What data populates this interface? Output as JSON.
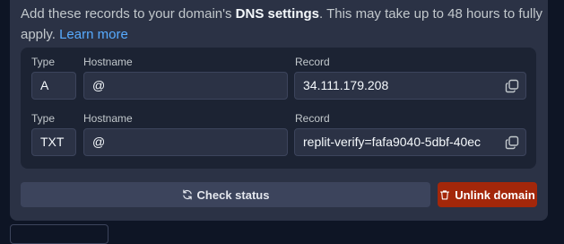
{
  "intro": {
    "prefix": "Add these records to your domain's ",
    "emphasis": "DNS settings",
    "suffix": ". This may take up to 48 hours to fully apply. ",
    "link": "Learn more"
  },
  "columns": {
    "type": "Type",
    "hostname": "Hostname",
    "record": "Record"
  },
  "records": [
    {
      "type": "A",
      "hostname": "@",
      "record": "34.111.179.208"
    },
    {
      "type": "TXT",
      "hostname": "@",
      "record": "replit-verify=fafa9040-5dbf-40ec"
    }
  ],
  "actions": {
    "check_status": "Check status",
    "unlink_domain": "Unlink domain"
  },
  "colors": {
    "background": "#0e1525",
    "panel": "#2b3245",
    "link": "#57abff",
    "danger": "#a3270a"
  },
  "icons": [
    "copy-icon",
    "refresh-icon",
    "trash-icon"
  ]
}
